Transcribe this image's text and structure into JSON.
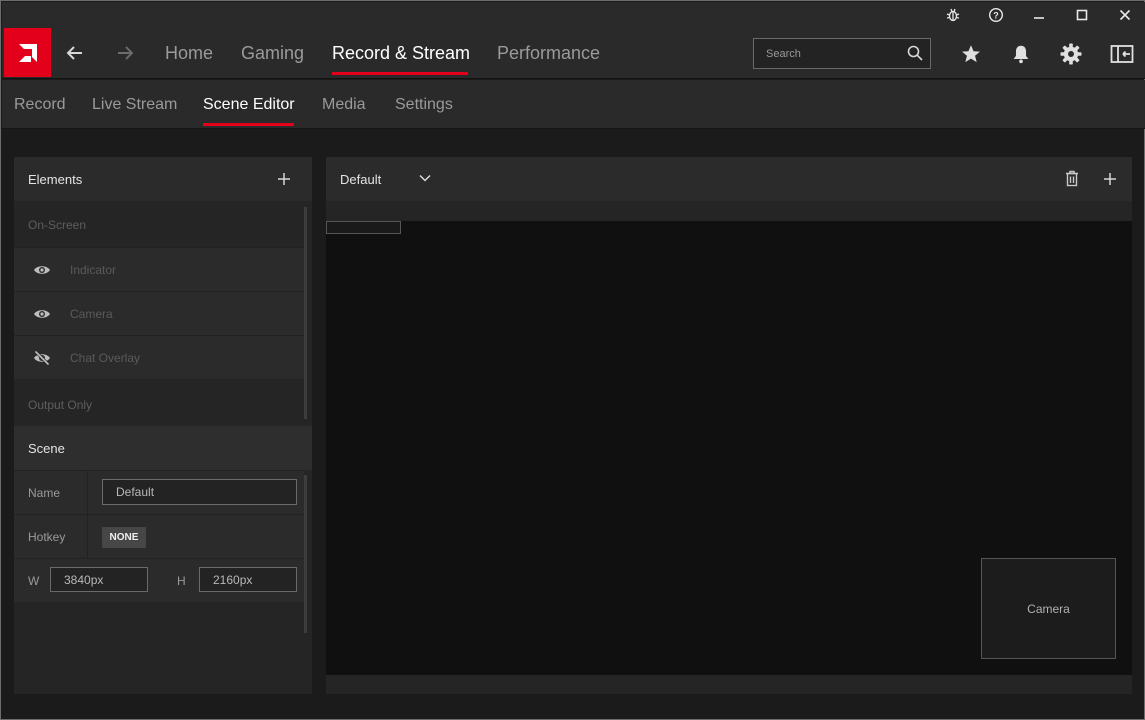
{
  "window_controls": [
    "bug-report-icon",
    "help-icon",
    "minimize-icon",
    "maximize-icon",
    "close-icon"
  ],
  "header": {
    "logo": "amd-logo",
    "back_icon": "arrow-left-icon",
    "forward_icon": "arrow-right-icon",
    "tabs": [
      {
        "label": "Home",
        "active": false
      },
      {
        "label": "Gaming",
        "active": false
      },
      {
        "label": "Record & Stream",
        "active": true
      },
      {
        "label": "Performance",
        "active": false
      }
    ],
    "search": {
      "placeholder": "Search",
      "value": ""
    },
    "icons": [
      "star-icon",
      "bell-icon",
      "gear-icon",
      "sidebar-panel-icon"
    ]
  },
  "subnav": {
    "tabs": [
      {
        "label": "Record",
        "active": false
      },
      {
        "label": "Live Stream",
        "active": false
      },
      {
        "label": "Scene Editor",
        "active": true
      },
      {
        "label": "Media",
        "active": false
      },
      {
        "label": "Settings",
        "active": false
      }
    ]
  },
  "elements_panel": {
    "title": "Elements",
    "sections": {
      "on_screen": "On-Screen",
      "output_only": "Output Only"
    },
    "items": [
      {
        "label": "Indicator",
        "icon": "eye-icon",
        "visible": true
      },
      {
        "label": "Camera",
        "icon": "eye-icon",
        "visible": true
      },
      {
        "label": "Chat Overlay",
        "icon": "eye-off-icon",
        "visible": false
      }
    ]
  },
  "scene_panel": {
    "title": "Scene",
    "name_label": "Name",
    "name_value": "Default",
    "hotkey_label": "Hotkey",
    "hotkey_value": "NONE",
    "w_label": "W",
    "w_value": "3840px",
    "h_label": "H",
    "h_value": "2160px"
  },
  "canvas_panel": {
    "selected_scene": "Default",
    "camera_label": "Camera"
  },
  "colors": {
    "accent": "#e3001b",
    "background": "#1b1b1b",
    "panel": "#252525",
    "canvas": "#101010"
  }
}
